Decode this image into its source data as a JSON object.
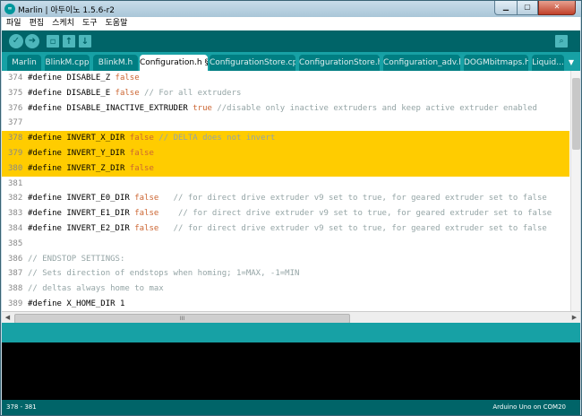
{
  "window": {
    "title": "Marlin | 아두이노 1.5.6-r2"
  },
  "app_icon": "arduino-icon",
  "menu": [
    "파일",
    "편집",
    "스케치",
    "도구",
    "도움말"
  ],
  "toolbar": {
    "icons": [
      "verify-icon",
      "upload-icon",
      "new-icon",
      "open-icon",
      "save-icon",
      "serial-monitor-icon"
    ]
  },
  "tabs": [
    {
      "label": "Marlin"
    },
    {
      "label": "BlinkM.cpp"
    },
    {
      "label": "BlinkM.h"
    },
    {
      "label": "Configuration.h §"
    },
    {
      "label": "ConfigurationStore.cpp"
    },
    {
      "label": "ConfigurationStore.h"
    },
    {
      "label": "Configuration_adv.h"
    },
    {
      "label": "DOGMbitmaps.h"
    },
    {
      "label": "Liquid..."
    }
  ],
  "active_tab": 3,
  "code_lines": [
    {
      "num": "374",
      "hl": false,
      "parts": [
        {
          "t": "#define DISABLE_Z "
        },
        {
          "t": "false",
          "c": "kw"
        }
      ]
    },
    {
      "num": "375",
      "hl": false,
      "parts": [
        {
          "t": "#define DISABLE_E "
        },
        {
          "t": "false",
          "c": "kw"
        },
        {
          "t": " // For all extruders",
          "c": "cm"
        }
      ]
    },
    {
      "num": "376",
      "hl": false,
      "parts": [
        {
          "t": "#define DISABLE_INACTIVE_EXTRUDER "
        },
        {
          "t": "true",
          "c": "kw"
        },
        {
          "t": " //disable only inactive extruders and keep active extruder enabled",
          "c": "cm"
        }
      ]
    },
    {
      "num": "377",
      "hl": false,
      "parts": []
    },
    {
      "num": "378",
      "hl": true,
      "parts": [
        {
          "t": "#define INVERT_X_DIR "
        },
        {
          "t": "false",
          "c": "kw"
        },
        {
          "t": " // DELTA does not invert",
          "c": "cm"
        }
      ]
    },
    {
      "num": "379",
      "hl": true,
      "parts": [
        {
          "t": "#define INVERT_Y_DIR "
        },
        {
          "t": "false",
          "c": "kw"
        }
      ]
    },
    {
      "num": "380",
      "hl": true,
      "parts": [
        {
          "t": "#define INVERT_Z_DIR "
        },
        {
          "t": "false",
          "c": "kw"
        }
      ]
    },
    {
      "num": "381",
      "hl": false,
      "parts": []
    },
    {
      "num": "382",
      "hl": false,
      "parts": [
        {
          "t": "#define INVERT_E0_DIR "
        },
        {
          "t": "false",
          "c": "kw"
        },
        {
          "t": "   // for direct drive extruder v9 set to true, for geared extruder set to false",
          "c": "cm"
        }
      ]
    },
    {
      "num": "383",
      "hl": false,
      "parts": [
        {
          "t": "#define INVERT_E1_DIR "
        },
        {
          "t": "false",
          "c": "kw"
        },
        {
          "t": "    // for direct drive extruder v9 set to true, for geared extruder set to false",
          "c": "cm"
        }
      ]
    },
    {
      "num": "384",
      "hl": false,
      "parts": [
        {
          "t": "#define INVERT_E2_DIR "
        },
        {
          "t": "false",
          "c": "kw"
        },
        {
          "t": "   // for direct drive extruder v9 set to true, for geared extruder set to false",
          "c": "cm"
        }
      ]
    },
    {
      "num": "385",
      "hl": false,
      "parts": []
    },
    {
      "num": "386",
      "hl": false,
      "parts": [
        {
          "t": "// ENDSTOP SETTINGS:",
          "c": "cm"
        }
      ]
    },
    {
      "num": "387",
      "hl": false,
      "parts": [
        {
          "t": "// Sets direction of endstops when homing; 1=MAX, -1=MIN",
          "c": "cm"
        }
      ]
    },
    {
      "num": "388",
      "hl": false,
      "parts": [
        {
          "t": "// deltas always home to max",
          "c": "cm"
        }
      ]
    },
    {
      "num": "389",
      "hl": false,
      "parts": [
        {
          "t": "#define X_HOME_DIR 1"
        }
      ]
    }
  ],
  "hscroll_grip": "III",
  "status": {
    "left": "378 - 381",
    "right": "Arduino Uno on COM20"
  }
}
